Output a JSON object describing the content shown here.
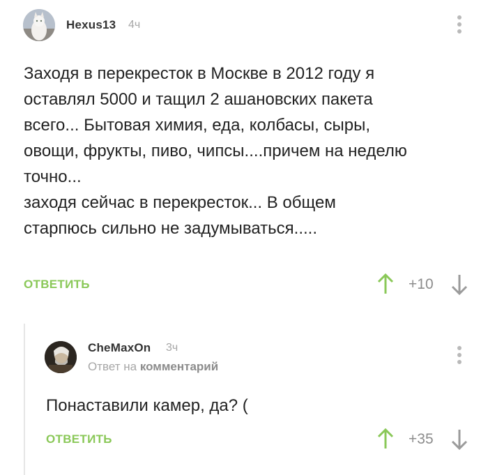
{
  "comments": [
    {
      "username": "Hexus13",
      "time": "4ч",
      "text": "Заходя в перекресток в Москве в 2012 году я\nоставлял 5000 и тащил 2 ашановских пакета\nвсего... Бытовая химия, еда, колбасы, сыры,\nовощи, фрукты, пиво, чипсы....причем на неделю\nточно...\nзаходя сейчас в перекресток... В общем\nстарпюсь сильно не задумываться.....",
      "reply_label": "ОТВЕТИТЬ",
      "rating": "+10"
    },
    {
      "username": "CheMaxOn",
      "time": "3ч",
      "reply_to_prefix": "Ответ на",
      "reply_to_link": "комментарий",
      "text": "Понаставили камер, да? (",
      "reply_label": "ОТВЕТИТЬ",
      "rating": "+35"
    }
  ],
  "icons": {
    "more": "more-vertical-icon",
    "upvote": "arrow-up-icon",
    "downvote": "arrow-down-icon"
  },
  "colors": {
    "accent_green": "#8ac858",
    "upvote_green": "#8ac858",
    "muted_gray": "#a6a6a6"
  }
}
